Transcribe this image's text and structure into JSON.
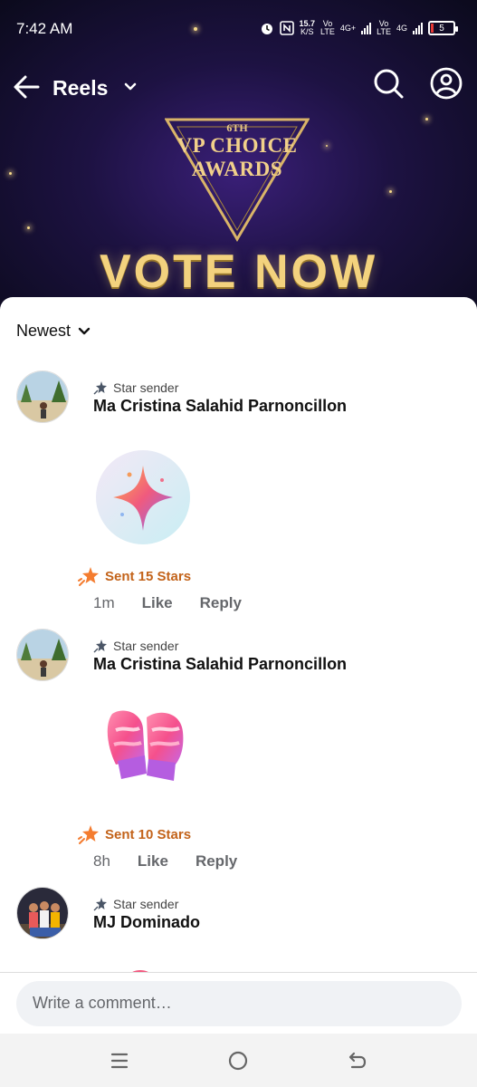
{
  "status": {
    "time": "7:42 AM",
    "speed_value": "15.7",
    "speed_unit": "K/S",
    "net1_top": "Vo",
    "net1_bottom": "LTE",
    "net1_type": "4G+",
    "net2_top": "Vo",
    "net2_bottom": "LTE",
    "net2_type": "4G",
    "battery": "5"
  },
  "header": {
    "title": "Reels"
  },
  "video": {
    "award_line1": "6TH",
    "award_line2": "VP CHOICE",
    "award_line3": "AWARDS",
    "cta": "VOTE NOW"
  },
  "sheet": {
    "sort_label": "Newest",
    "comments": [
      {
        "badge": "Star sender",
        "name": "Ma Cristina Salahid Parnoncillon",
        "sticker": "sparkle-star",
        "sent": "Sent 15 Stars",
        "time": "1m",
        "like": "Like",
        "reply": "Reply"
      },
      {
        "badge": "Star sender",
        "name": "Ma Cristina Salahid Parnoncillon",
        "sticker": "mittens",
        "sent": "Sent 10 Stars",
        "time": "8h",
        "like": "Like",
        "reply": "Reply"
      },
      {
        "badge": "Star sender",
        "name": "MJ Dominado"
      }
    ],
    "composer_placeholder": "Write a comment…"
  },
  "colors": {
    "star_orange": "#f47c2f",
    "sent_text": "#c3631a",
    "gold": "#f1d08a"
  }
}
